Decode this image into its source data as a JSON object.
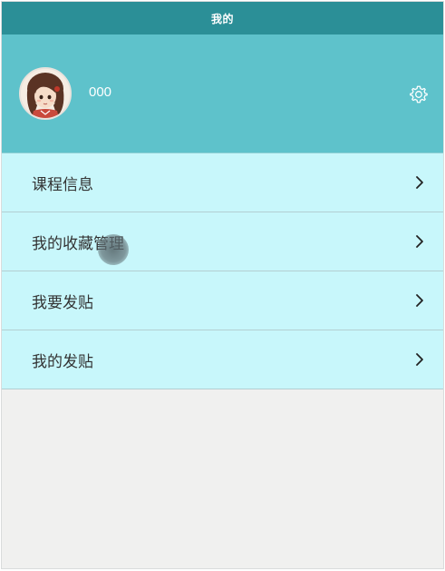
{
  "header": {
    "title": "我的"
  },
  "profile": {
    "username": "000",
    "avatar_icon": "avatar-portrait",
    "settings_icon": "gear-icon"
  },
  "menu": {
    "items": [
      {
        "label": "课程信息",
        "icon": "chevron-right-icon"
      },
      {
        "label": "我的收藏管理",
        "icon": "chevron-right-icon"
      },
      {
        "label": "我要发贴",
        "icon": "chevron-right-icon"
      },
      {
        "label": "我的发贴",
        "icon": "chevron-right-icon"
      }
    ]
  },
  "colors": {
    "title_bar": "#2b8f97",
    "profile_bg": "#5ec2cb",
    "menu_bg": "#c8f7fb",
    "page_bg": "#f0f0ef"
  }
}
